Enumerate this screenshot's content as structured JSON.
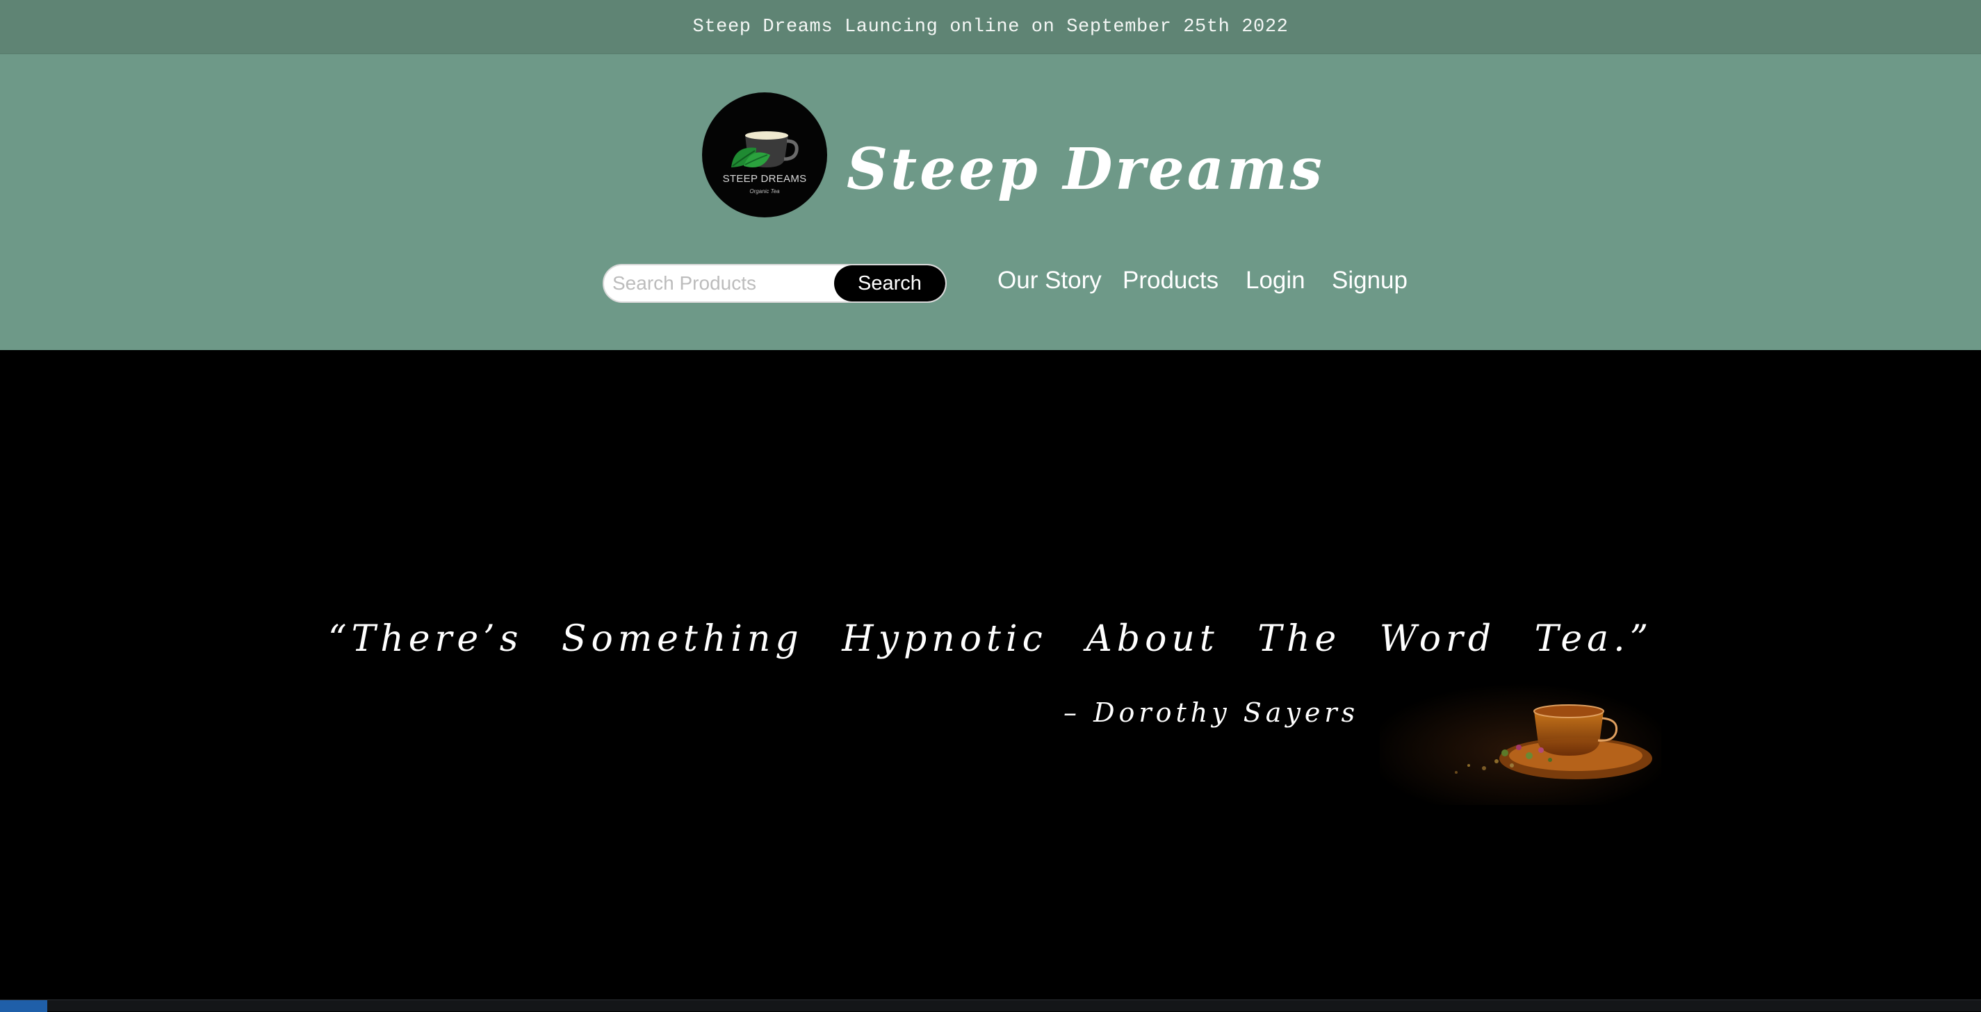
{
  "announcement": {
    "text": "Steep Dreams Launcing online on September 25th 2022"
  },
  "logo": {
    "name": "STEEP DREAMS",
    "tagline": "Organic Tea",
    "icon": "teacup-leaves-icon"
  },
  "brand": {
    "title": "Steep Dreams"
  },
  "search": {
    "placeholder": "Search Products",
    "value": "",
    "button_label": "Search"
  },
  "nav": {
    "items": [
      {
        "label": "Our Story"
      },
      {
        "label": "Products"
      },
      {
        "label": "Login"
      },
      {
        "label": "Signup"
      }
    ]
  },
  "hero": {
    "quote": "“There’s Something Hypnotic About The Word Tea.”",
    "author": "– Dorothy Sayers",
    "image": "teacup-on-saucer-image"
  },
  "colors": {
    "announcement_bg": "#5f8474",
    "header_bg": "#6e9988",
    "hero_bg": "#000000",
    "text": "#ffffff"
  }
}
